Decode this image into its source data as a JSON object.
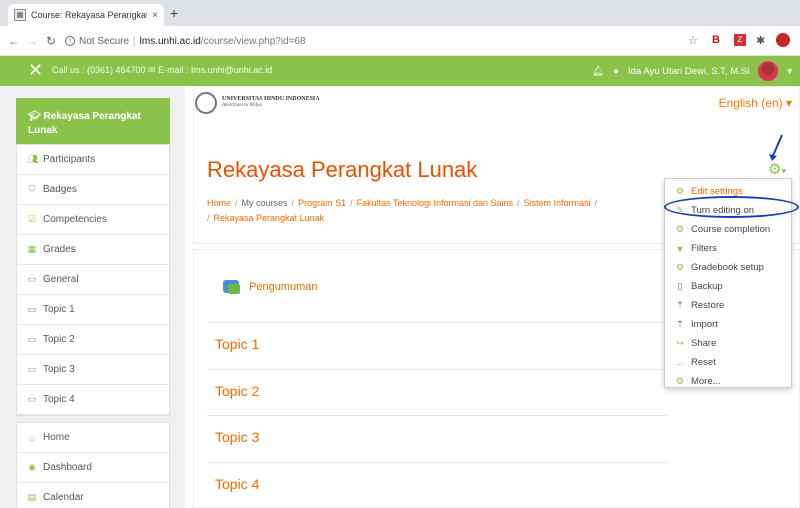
{
  "browser": {
    "tab_title": "Course: Rekayasa Perangkat L",
    "tab_close": "×",
    "new_tab": "+",
    "not_secure": "Not Secure",
    "url_host": "lms.unhi.ac.id",
    "url_path": "/course/view.php?id=68"
  },
  "navbar": {
    "contact": "Call us : (0361) 464700 ✉ E-mail : lms.unhi@unhi.ac.id",
    "user_name": "Ida Ayu Utari Dewi, S.T, M.Si",
    "accent_color": "#8bc34a"
  },
  "sidebar": {
    "course": "Rekayasa Perangkat Lunak",
    "items": [
      {
        "label": "Participants",
        "icon": "users-icon"
      },
      {
        "label": "Badges",
        "icon": "shield-icon"
      },
      {
        "label": "Competencies",
        "icon": "checkbox-icon"
      },
      {
        "label": "Grades",
        "icon": "table-icon"
      },
      {
        "label": "General",
        "icon": "folder-icon"
      },
      {
        "label": "Topic 1",
        "icon": "folder-icon"
      },
      {
        "label": "Topic 2",
        "icon": "folder-icon"
      },
      {
        "label": "Topic 3",
        "icon": "folder-icon"
      },
      {
        "label": "Topic 4",
        "icon": "folder-icon"
      }
    ],
    "items2": [
      {
        "label": "Home",
        "icon": "home-icon"
      },
      {
        "label": "Dashboard",
        "icon": "dashboard-icon"
      },
      {
        "label": "Calendar",
        "icon": "calendar-icon"
      }
    ]
  },
  "header": {
    "logo_name": "UNIVERSITAS HINDU INDONESIA",
    "logo_tag": "Amertham tu Widya",
    "language": "English (en) ▾",
    "course_title": "Rekayasa Perangkat Lunak",
    "breadcrumb": {
      "home": "Home",
      "my_courses": "My courses",
      "program": "Program S1",
      "faculty": "Fakultas Teknologi Informasi dan Sains",
      "dept": "Sistem Informasi",
      "course": "Rekayasa Perangkat Lunak"
    }
  },
  "menu": {
    "items": [
      {
        "label": "Edit settings",
        "icon": "gear-icon"
      },
      {
        "label": "Turn editing on",
        "icon": "pencil-icon"
      },
      {
        "label": "Course completion",
        "icon": "gear-icon"
      },
      {
        "label": "Filters",
        "icon": "filter-icon"
      },
      {
        "label": "Gradebook setup",
        "icon": "gear-icon"
      },
      {
        "label": "Backup",
        "icon": "file-icon"
      },
      {
        "label": "Restore",
        "icon": "upload-icon"
      },
      {
        "label": "Import",
        "icon": "upload-icon"
      },
      {
        "label": "Share",
        "icon": "share-icon"
      },
      {
        "label": "Reset",
        "icon": "back-icon"
      },
      {
        "label": "More...",
        "icon": "gear-icon"
      }
    ]
  },
  "content": {
    "announcement": "Pengumuman",
    "topics": [
      "Topic 1",
      "Topic 2",
      "Topic 3",
      "Topic 4"
    ]
  }
}
